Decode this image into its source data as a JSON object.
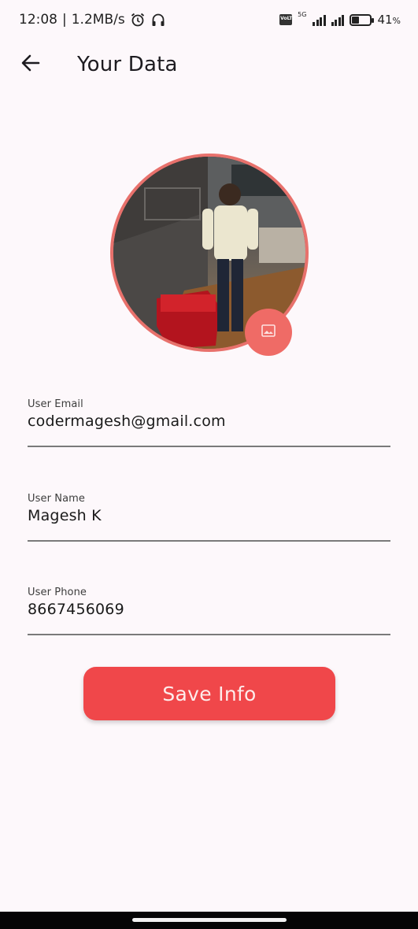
{
  "status_bar": {
    "time": "12:08",
    "separator": "|",
    "network_speed": "1.2MB/s",
    "network_type": "5G",
    "battery_percent": "41",
    "battery_suffix": "%",
    "battery_level": 0.41,
    "icons": [
      "alarm-icon",
      "headphones-icon",
      "volte-icon",
      "signal-icon",
      "battery-icon"
    ]
  },
  "app_bar": {
    "title": "Your Data",
    "back_icon": "arrow-left-icon"
  },
  "profile": {
    "border_color": "#e8716c",
    "pick_image_icon": "image-icon",
    "pick_button_color": "#ef6b66"
  },
  "fields": {
    "email": {
      "label": "User Email",
      "value": "codermagesh@gmail.com"
    },
    "name": {
      "label": "User Name",
      "value": "Magesh K"
    },
    "phone": {
      "label": "User Phone",
      "value": "8667456069"
    }
  },
  "actions": {
    "save_label": "Save Info",
    "save_color": "#f0474a"
  }
}
